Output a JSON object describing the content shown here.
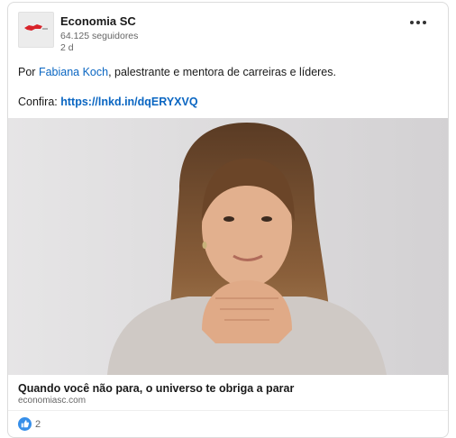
{
  "post": {
    "author_name": "Economia SC",
    "followers": "64.125 seguidores",
    "time_ago": "2 d",
    "text_prefix": "Por ",
    "mention": "Fabiana Koch",
    "text_suffix": ", palestrante e mentora de carreiras e líderes.",
    "link_prefix": "Confira: ",
    "link": "https://lnkd.in/dqERYXVQ",
    "more_icon": "more-options-icon",
    "logo_icon": "economia-sc-logo"
  },
  "article": {
    "title": "Quando você não para, o universo te obriga a parar",
    "source": "economiasc.com",
    "image_alt": "Woman with long brown hair resting chin on clasped hands"
  },
  "reactions": {
    "count": "2",
    "icon": "like-icon"
  },
  "colors": {
    "link": "#0a66c2",
    "like": "#378fe9",
    "logo_red": "#d8232a"
  }
}
